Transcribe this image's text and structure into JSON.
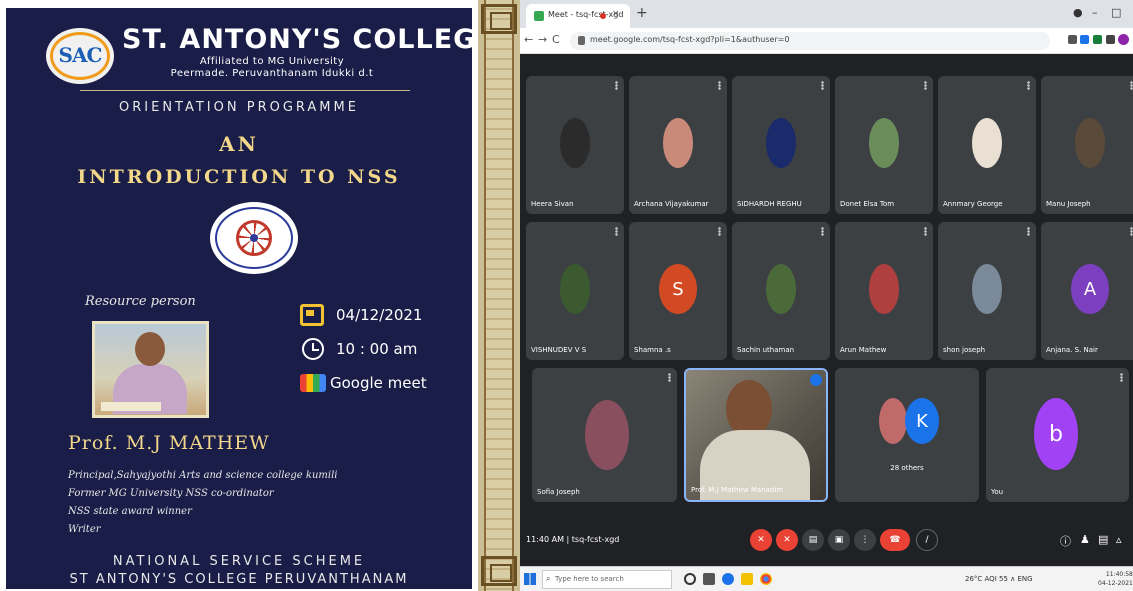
{
  "poster": {
    "logo_text": "SAC",
    "college_name": "ST. ANTONY'S COLLEGE",
    "affiliated": "Affiliated to MG University",
    "address": "Peermade. Peruvanthanam Idukki d.t",
    "programme": "ORIENTATION PROGRAMME",
    "title_line1": "AN",
    "title_line2": "INTRODUCTION TO NSS",
    "resource_label": "Resource person",
    "date": "04/12/2021",
    "time": "10 : 00 am",
    "platform": "Google meet",
    "speaker": "Prof. M.J MATHEW",
    "credentials": [
      "Principal,Sahyajyothi Arts and science college kumili",
      "Former MG University NSS co-ordinator",
      "NSS state award winner",
      "Writer"
    ],
    "footer_line1": "NATIONAL SERVICE SCHEME",
    "footer_line2": "ST ANTONY'S COLLEGE PERUVANTHANAM"
  },
  "browser": {
    "tab_title": "Meet - tsq-fcst-xgd",
    "tab_close": "×",
    "new_tab": "+",
    "url": "meet.google.com/tsq-fcst-xgd?pli=1&authuser=0",
    "nav_back": "←",
    "nav_forward": "→",
    "nav_reload": "C"
  },
  "meet": {
    "participants_row1": [
      {
        "name": "Heera Sivan",
        "color": "#2b2b2b"
      },
      {
        "name": "Archana Vijayakumar",
        "color": "#c98a7a"
      },
      {
        "name": "SIDHARDH REGHU",
        "color": "#1b2a6b"
      },
      {
        "name": "Donet Elsa Tom",
        "color": "#6a8d5a"
      },
      {
        "name": "Annmary George",
        "color": "#e9e0d3"
      },
      {
        "name": "Manu Joseph",
        "color": "#5a4a3a"
      }
    ],
    "participants_row2": [
      {
        "name": "VISHNUDEV V S",
        "color": "#3b5a2f",
        "letter": ""
      },
      {
        "name": "Shamna .s",
        "color": "#d24a24",
        "letter": "S"
      },
      {
        "name": "Sachin uthaman",
        "color": "#4b6a3a",
        "letter": ""
      },
      {
        "name": "Arun Mathew",
        "color": "#b04040",
        "letter": ""
      },
      {
        "name": "shon joseph",
        "color": "#7a8a9a",
        "letter": ""
      },
      {
        "name": "Anjana. S. Nair",
        "color": "#7b3fbf",
        "letter": "A"
      }
    ],
    "row3": {
      "left_name": "Sofia Joseph",
      "speaker_name": "Prof. M.J Mathew Manadim",
      "others_label": "28 others",
      "others_letter": "K",
      "you_label": "You",
      "you_letter": "b"
    },
    "meeting_time": "11:40 AM",
    "meeting_code": "tsq-fcst-xgd"
  },
  "taskbar": {
    "search_placeholder": "Type here to search",
    "tray": "26°C AQI 55  ∧  ENG",
    "clock_time": "11:40:58",
    "clock_date": "04-12-2021"
  },
  "colors": {
    "poster_bg": "#191d47",
    "gold": "#f3d78a",
    "meet_bg": "#202124",
    "tile_bg": "#3c4043",
    "end_call": "#ea4335"
  }
}
